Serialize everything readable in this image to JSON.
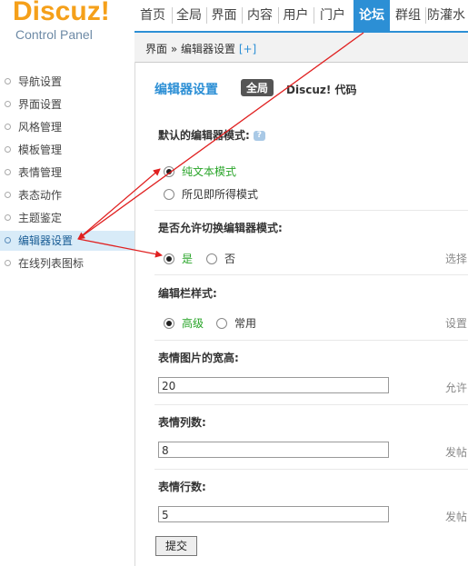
{
  "logo": {
    "word": "Discuz!",
    "sub": "Control Panel"
  },
  "topnav": {
    "tabs": [
      "首页",
      "全局",
      "界面",
      "内容",
      "用户",
      "门户",
      "论坛",
      "群组",
      "防灌水"
    ],
    "active_index": 6
  },
  "breadcrumb": {
    "path": "界面 » 编辑器设置",
    "add": "[+]"
  },
  "sidebar": {
    "items": [
      "导航设置",
      "界面设置",
      "风格管理",
      "模板管理",
      "表情管理",
      "表态动作",
      "主题鉴定",
      "编辑器设置",
      "在线列表图标"
    ],
    "active_index": 7
  },
  "main": {
    "title": "编辑器设置",
    "badge": "全局",
    "badge_text": "Discuz! 代码",
    "q1": {
      "label": "默认的编辑器模式:",
      "help": "?",
      "options": [
        "纯文本模式",
        "所见即所得模式"
      ],
      "selected": 0
    },
    "q2": {
      "label": "是否允许切换编辑器模式:",
      "options": [
        "是",
        "否"
      ],
      "selected": 0,
      "hint": "选择"
    },
    "q3": {
      "label": "编辑栏样式:",
      "options": [
        "高级",
        "常用"
      ],
      "selected": 0,
      "hint": "设置"
    },
    "q4": {
      "label": "表情图片的宽高:",
      "value": "20",
      "hint": "允许"
    },
    "q5": {
      "label": "表情列数:",
      "value": "8",
      "hint": "发帖"
    },
    "q6": {
      "label": "表情行数:",
      "value": "5",
      "hint": "发帖"
    },
    "submit": "提交"
  },
  "colors": {
    "accent": "#2c8fd5",
    "logo": "#f5a01a",
    "selected_option": "#2aa52a",
    "annotation_arrow": "#e02020"
  }
}
